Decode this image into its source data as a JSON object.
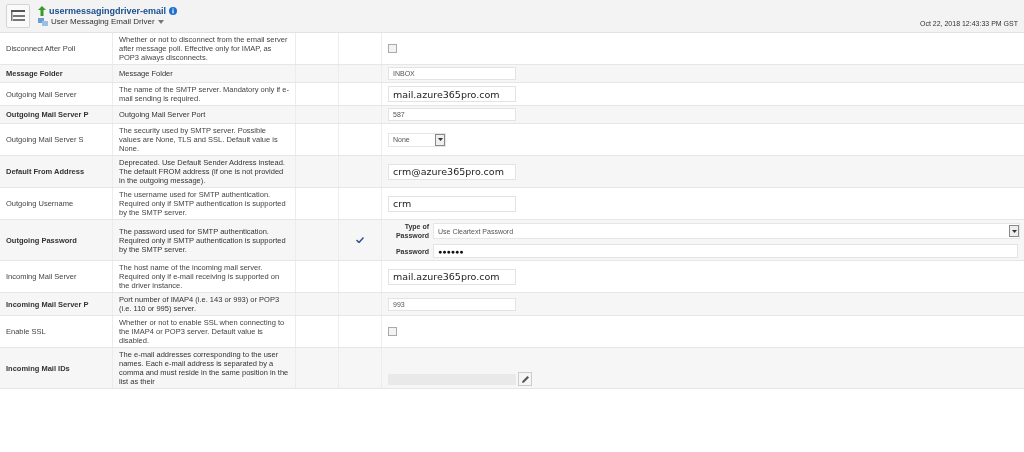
{
  "header": {
    "title": "usermessagingdriver-email",
    "subtitle": "User Messaging Email Driver",
    "timestamp": "Oct 22, 2018 12:43:33 PM GST"
  },
  "rows": [
    {
      "name": "Disconnect After Poll",
      "highlighted": false,
      "description": "Whether or not to disconnect from the email server after message poll. Effective only for IMAP, as POP3 always disconnects.",
      "flag": false,
      "value": {
        "kind": "checkbox",
        "checked": false
      }
    },
    {
      "name": "Message Folder",
      "highlighted": true,
      "description": "Message Folder",
      "flag": false,
      "value": {
        "kind": "input",
        "large": false,
        "text": "INBOX"
      }
    },
    {
      "name": "Outgoing Mail Server",
      "highlighted": false,
      "description": "The name of the SMTP server. Mandatory only if e-mail sending is required.",
      "flag": false,
      "value": {
        "kind": "input",
        "large": true,
        "text": "mail.azure365pro.com"
      }
    },
    {
      "name": "Outgoing Mail Server P",
      "highlighted": true,
      "description": "Outgoing Mail Server Port",
      "flag": false,
      "value": {
        "kind": "input",
        "large": false,
        "text": "587"
      }
    },
    {
      "name": "Outgoing Mail Server S",
      "highlighted": false,
      "description": "The security used by SMTP server. Possible values are None, TLS and SSL. Default value is None.",
      "flag": false,
      "value": {
        "kind": "select",
        "text": "None"
      }
    },
    {
      "name": "Default From Address",
      "highlighted": true,
      "description": "Deprecated. Use Default Sender Address instead. The default FROM address (if one is not provided in the outgoing message).",
      "flag": false,
      "value": {
        "kind": "input",
        "large": true,
        "text": "crm@azure365pro.com"
      }
    },
    {
      "name": "Outgoing Username",
      "highlighted": false,
      "description": "The username used for SMTP authentication. Required only if SMTP authentication is supported by the SMTP server.",
      "flag": false,
      "value": {
        "kind": "input",
        "large": true,
        "text": "crm"
      }
    },
    {
      "name": "Outgoing Password",
      "highlighted": true,
      "description": "The password used for SMTP authentication. Required only if SMTP authentication is supported by the SMTP server.",
      "flag": true,
      "value": {
        "kind": "password",
        "type_label": "Type of Password",
        "type_value": "Use Cleartext Password",
        "password_label": "Password",
        "password_value": "●●●●●●"
      }
    },
    {
      "name": "Incoming Mail Server",
      "highlighted": false,
      "description": "The host name of the incoming mail server. Required only if e-mail receiving is supported on the driver instance.",
      "flag": false,
      "value": {
        "kind": "input",
        "large": true,
        "text": "mail.azure365pro.com"
      }
    },
    {
      "name": "Incoming Mail Server P",
      "highlighted": true,
      "description": "Port number of IMAP4 (i.e. 143 or 993) or POP3 (i.e. 110 or 995) server.",
      "flag": false,
      "value": {
        "kind": "input",
        "large": false,
        "text": "993"
      }
    },
    {
      "name": "Enable SSL",
      "highlighted": false,
      "description": "Whether or not to enable SSL when connecting to the IMAP4 or POP3 server. Default value is disabled.",
      "flag": false,
      "value": {
        "kind": "checkbox",
        "checked": false
      }
    },
    {
      "name": "Incoming Mail IDs",
      "highlighted": true,
      "description": "The e-mail addresses corresponding to the user names. Each e-mail address is separated by a comma and must reside in the same position in the list as their",
      "flag": false,
      "value": {
        "kind": "readonly-edit"
      }
    }
  ]
}
